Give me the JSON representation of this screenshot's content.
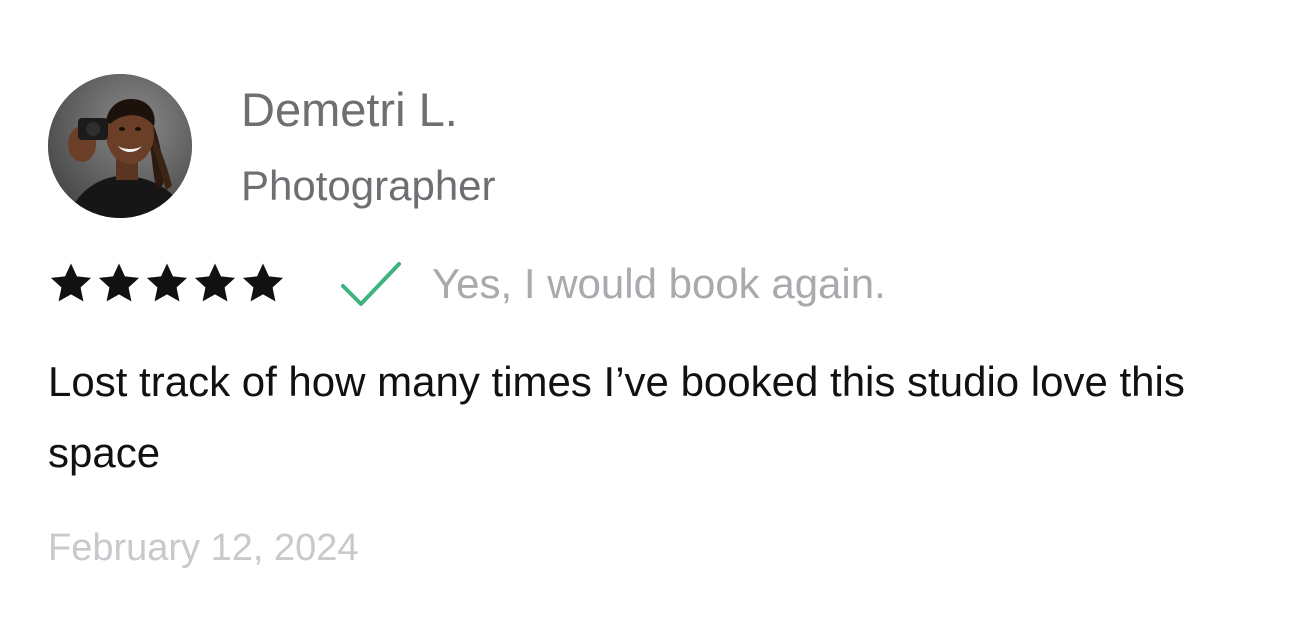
{
  "review": {
    "reviewer": {
      "name": "Demetri L.",
      "role": "Photographer",
      "avatar_icon": "person-photo"
    },
    "rating": {
      "stars_filled": 5,
      "stars_total": 5,
      "star_color": "#111111"
    },
    "recommendation": {
      "icon": "checkmark-icon",
      "icon_color": "#3fb37f",
      "text": "Yes, I would book again."
    },
    "body": "Lost track of how many times I’ve booked this studio love this space",
    "date": "February 12, 2024"
  }
}
